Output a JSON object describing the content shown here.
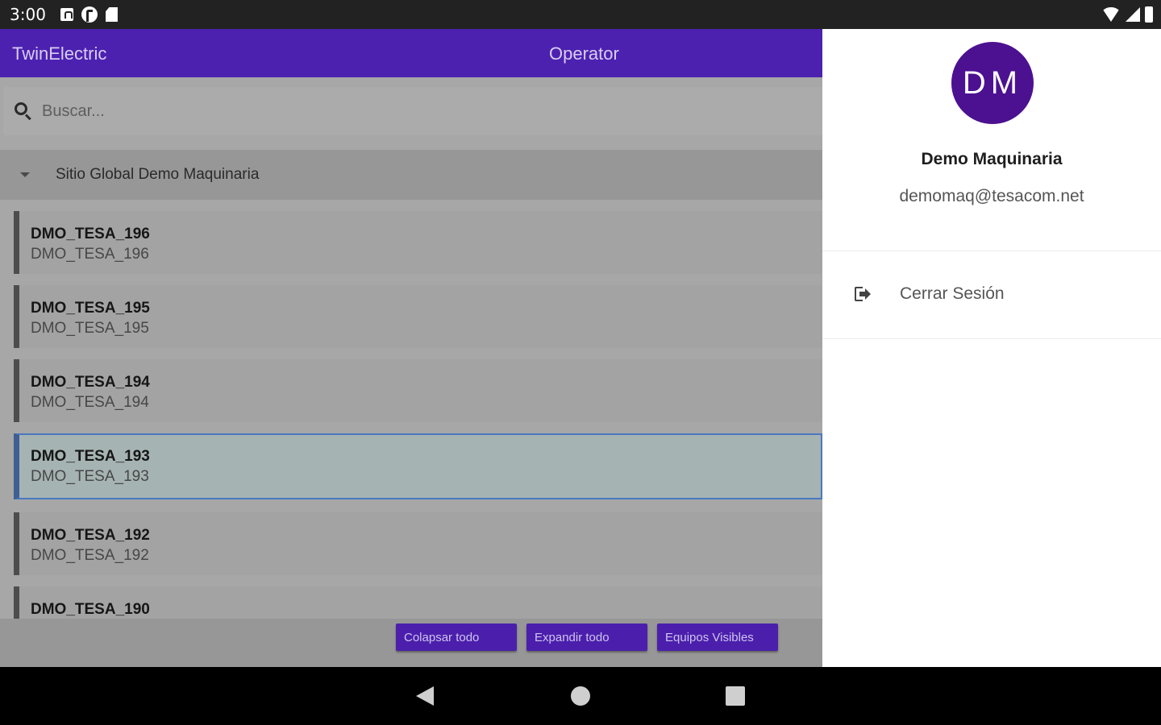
{
  "status_bar": {
    "time": "3:00"
  },
  "app_bar": {
    "title": "TwinElectric",
    "role": "Operator"
  },
  "search": {
    "placeholder": "Buscar..."
  },
  "group": {
    "label": "Sitio Global Demo Maquinaria"
  },
  "devices": [
    {
      "title": "DMO_TESA_196",
      "subtitle": "DMO_TESA_196"
    },
    {
      "title": "DMO_TESA_195",
      "subtitle": "DMO_TESA_195"
    },
    {
      "title": "DMO_TESA_194",
      "subtitle": "DMO_TESA_194"
    },
    {
      "title": "DMO_TESA_193",
      "subtitle": "DMO_TESA_193",
      "selected": true
    },
    {
      "title": "DMO_TESA_192",
      "subtitle": "DMO_TESA_192"
    },
    {
      "title": "DMO_TESA_190",
      "subtitle": ""
    }
  ],
  "actions": {
    "collapse_label": "Colapsar todo",
    "expand_label": "Expandir todo",
    "visible_label": "Equipos Visibles"
  },
  "drawer": {
    "avatar_initials": "DM",
    "user_name": "Demo Maquinaria",
    "user_email": "demomaq@tesacom.net",
    "logout_label": "Cerrar Sesión"
  },
  "colors": {
    "app_bar": "#4c21b0",
    "avatar": "#4c1190",
    "button": "#4b1fac",
    "selection_border": "#4a78c0"
  }
}
